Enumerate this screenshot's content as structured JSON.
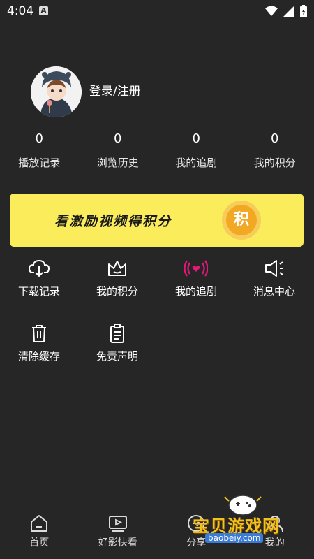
{
  "status_bar": {
    "time": "4:04",
    "notification_letter": "A"
  },
  "profile": {
    "login_label": "登录/注册"
  },
  "stats": [
    {
      "value": "0",
      "label": "播放记录"
    },
    {
      "value": "0",
      "label": "浏览历史"
    },
    {
      "value": "0",
      "label": "我的追剧"
    },
    {
      "value": "0",
      "label": "我的积分"
    }
  ],
  "banner": {
    "text": "看激励视频得积分",
    "coin_char": "积",
    "colors": {
      "background": "#fbec5c",
      "coin": "#f2a823"
    }
  },
  "menu": [
    {
      "label": "下载记录",
      "icon": "cloud-download-icon"
    },
    {
      "label": "我的积分",
      "icon": "crown-icon"
    },
    {
      "label": "我的追剧",
      "icon": "broadcast-heart-icon"
    },
    {
      "label": "消息中心",
      "icon": "speaker-icon"
    },
    {
      "label": "清除缓存",
      "icon": "trash-icon"
    },
    {
      "label": "免责声明",
      "icon": "clipboard-icon"
    }
  ],
  "bottom_nav": [
    {
      "label": "首页",
      "icon": "home-icon"
    },
    {
      "label": "好影快看",
      "icon": "video-icon"
    },
    {
      "label": "分享",
      "icon": "share-icon"
    },
    {
      "label": "我的",
      "icon": "profile-icon"
    }
  ],
  "watermark": {
    "title": "宝贝游戏网",
    "url": "baobeiy.com"
  },
  "accent_color": "#e5177b"
}
